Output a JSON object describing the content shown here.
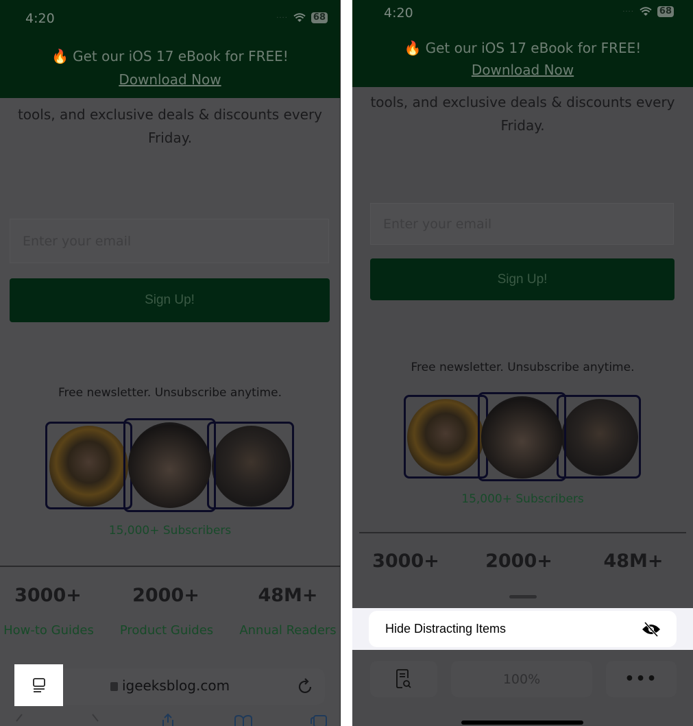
{
  "status_bar": {
    "time": "4:20",
    "battery": "68"
  },
  "banner": {
    "promo_text": "Get our iOS 17 eBook for FREE!",
    "download_link": "Download Now"
  },
  "content": {
    "intro_line1": "tools, and exclusive deals & discounts every",
    "intro_line2": "Friday.",
    "email_placeholder": "Enter your email",
    "signup_label": "Sign Up!",
    "newsletter_note": "Free newsletter. Unsubscribe anytime.",
    "subscribers": "15,000+ Subscribers",
    "stats": [
      {
        "value": "3000+",
        "label": "How-to Guides"
      },
      {
        "value": "2000+",
        "label": "Product Guides"
      },
      {
        "value": "48M+",
        "label": "Annual Readers"
      }
    ]
  },
  "address_bar": {
    "url": "igeeksblog.com"
  },
  "page_menu": {
    "hide_distracting_label": "Hide Distracting Items",
    "zoom_level": "100%",
    "more_label": "•••"
  },
  "colors": {
    "banner_green": "#02240f",
    "accent_green": "#174a28",
    "dim_overlay": "#4d4d4f"
  },
  "icons": {
    "page_menu": "page-menu-icon",
    "lock": "lock-icon",
    "reload": "reload-icon",
    "eye_slash": "eye-slash-icon",
    "reader": "reader-search-icon",
    "flame": "flame-icon",
    "wifi": "wifi-icon"
  }
}
